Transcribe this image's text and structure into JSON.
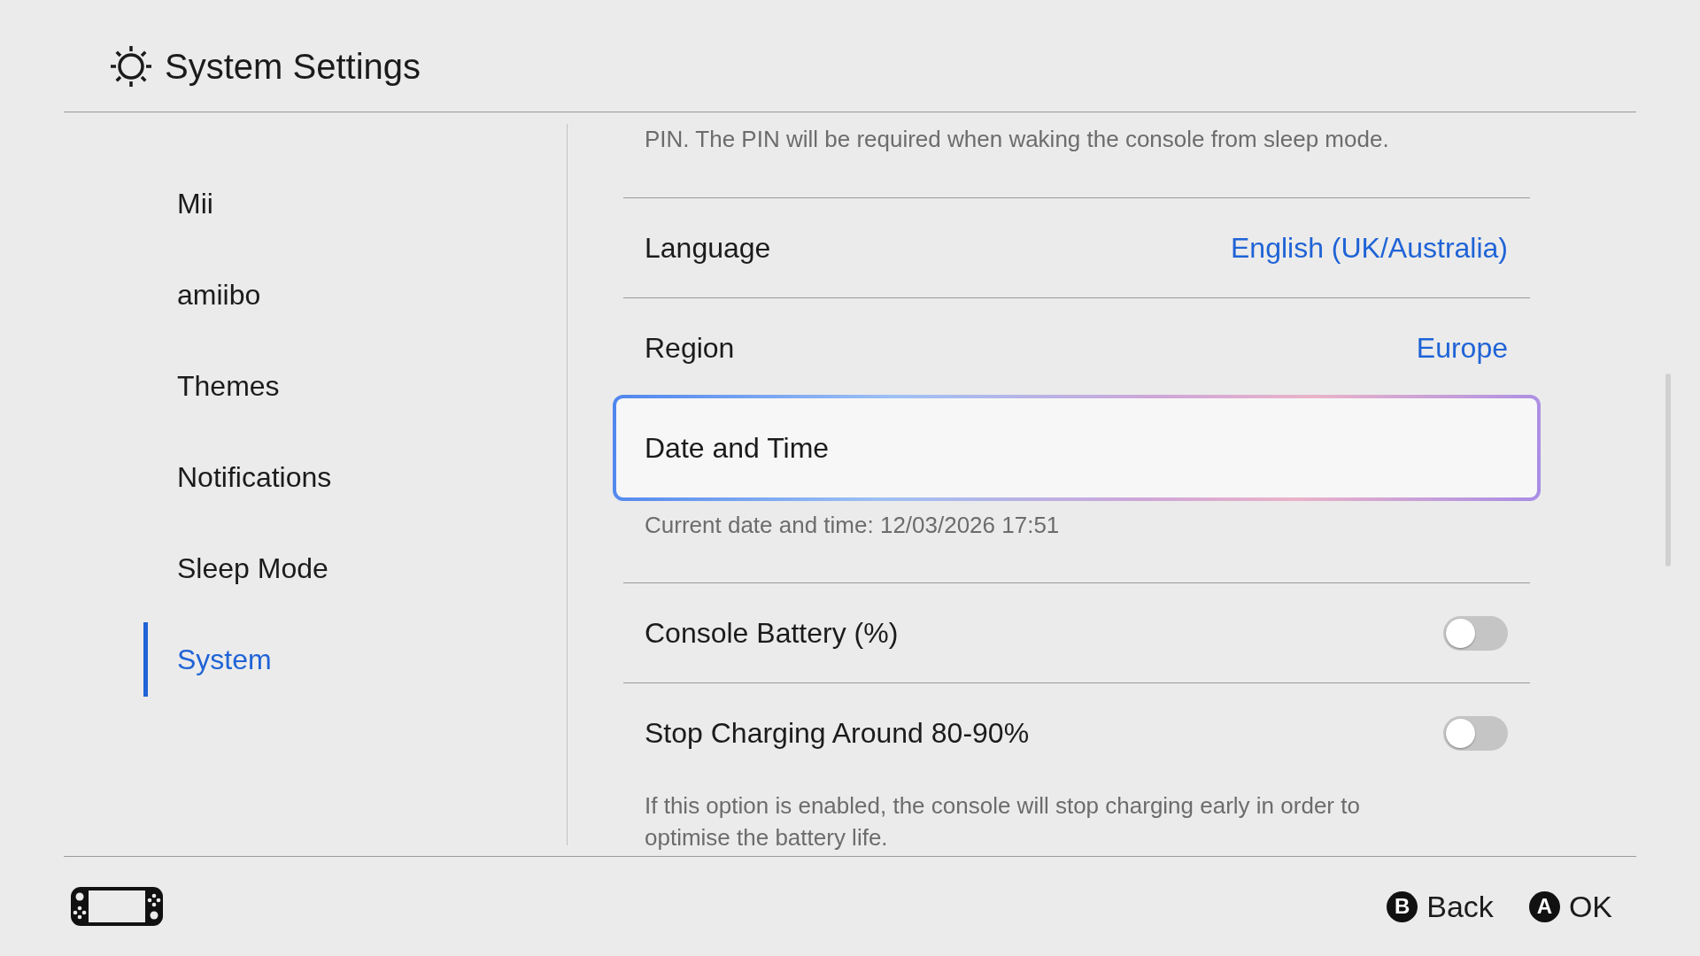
{
  "header": {
    "title": "System Settings"
  },
  "sidebar": {
    "items": [
      {
        "label": "Mii",
        "selected": false
      },
      {
        "label": "amiibo",
        "selected": false
      },
      {
        "label": "Themes",
        "selected": false
      },
      {
        "label": "Notifications",
        "selected": false
      },
      {
        "label": "Sleep Mode",
        "selected": false
      },
      {
        "label": "System",
        "selected": true
      }
    ]
  },
  "settings": {
    "intro_note": "PIN. The PIN will be required when waking the console from sleep mode.",
    "rows": [
      {
        "kind": "value",
        "label": "Language",
        "value": "English (UK/Australia)",
        "selected": false
      },
      {
        "kind": "value",
        "label": "Region",
        "value": "Europe",
        "selected": false
      },
      {
        "kind": "link",
        "label": "Date and Time",
        "selected": true,
        "note": "Current date and time: 12/03/2026 17:51"
      },
      {
        "kind": "toggle",
        "label": "Console Battery (%)",
        "on": false,
        "selected": false
      },
      {
        "kind": "toggle",
        "label": "Stop Charging Around 80-90%",
        "on": false,
        "selected": false,
        "note": "If this option is enabled, the console will stop charging early in order to optimise the battery life."
      }
    ]
  },
  "footer": {
    "buttons": [
      {
        "key": "B",
        "label": "Back"
      },
      {
        "key": "A",
        "label": "OK"
      }
    ]
  }
}
